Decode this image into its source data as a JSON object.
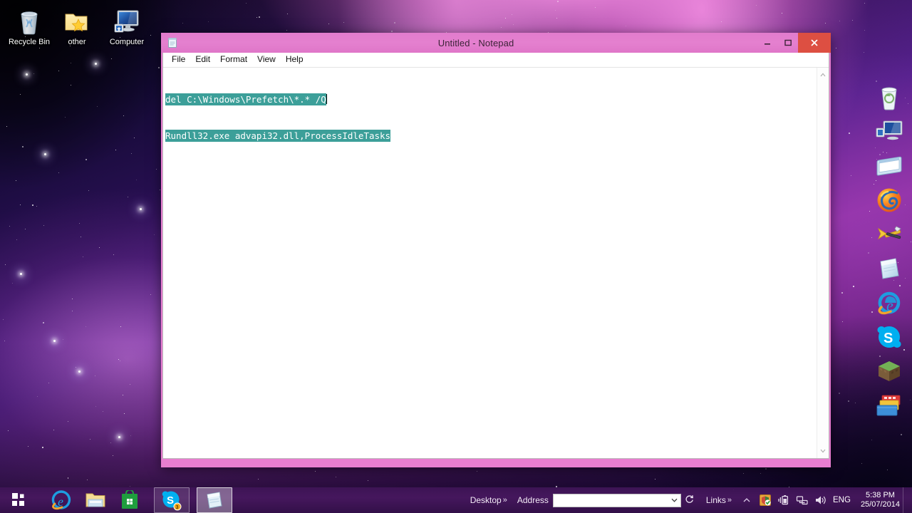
{
  "desktop": {
    "icons": [
      {
        "label": "Recycle Bin",
        "icon": "recycle-bin-icon"
      },
      {
        "label": "other",
        "icon": "folder-star-icon"
      },
      {
        "label": "Computer",
        "icon": "computer-icon"
      }
    ]
  },
  "dock": {
    "items": [
      {
        "name": "recycle-bin-icon",
        "label": "Recycle Bin"
      },
      {
        "name": "computer-icon",
        "label": "Computer"
      },
      {
        "name": "window-explorer-icon",
        "label": "Window"
      },
      {
        "name": "firefox-icon",
        "label": "Firefox"
      },
      {
        "name": "tools-icon",
        "label": "Tools"
      },
      {
        "name": "notepad-icon",
        "label": "Notepad"
      },
      {
        "name": "internet-explorer-icon",
        "label": "Internet Explorer"
      },
      {
        "name": "skype-icon",
        "label": "Skype"
      },
      {
        "name": "minecraft-icon",
        "label": "Minecraft"
      },
      {
        "name": "stack-folders-icon",
        "label": "Folders"
      }
    ]
  },
  "notepad": {
    "title": "Untitled - Notepad",
    "title_icon": "notepad-icon",
    "menus": [
      "File",
      "Edit",
      "Format",
      "View",
      "Help"
    ],
    "controls": {
      "minimize": "minimize-icon",
      "maximize": "maximize-icon",
      "close": "close-icon"
    },
    "content_lines": [
      "del C:\\Windows\\Prefetch\\*.* /Q",
      "Rundll32.exe advapi32.dll,ProcessIdleTasks"
    ],
    "selection_color": "#3c9f99",
    "scrollbar": {
      "up": "▲",
      "down": "▼"
    }
  },
  "taskbar": {
    "start": {
      "name": "start-button",
      "label": "Start"
    },
    "pinned": [
      {
        "name": "internet-explorer-icon",
        "label": "Internet Explorer"
      },
      {
        "name": "file-explorer-icon",
        "label": "File Explorer"
      },
      {
        "name": "windows-store-icon",
        "label": "Store"
      }
    ],
    "running": [
      {
        "name": "skype-icon",
        "label": "Skype",
        "badge": "3",
        "active": false
      },
      {
        "name": "notepad-icon",
        "label": "Untitled - Notepad",
        "badge": "",
        "active": true
      }
    ],
    "toolbars": {
      "desktop_label": "Desktop",
      "desktop_chevron": "»",
      "address_label": "Address",
      "address_value": "",
      "address_placeholder": "",
      "address_dropdown": "⌄",
      "address_refresh": "⟳",
      "links_label": "Links",
      "links_chevron": "»"
    },
    "tray": {
      "show_hidden": "▲",
      "icons": [
        {
          "name": "security-shield-icon",
          "label": "Security"
        },
        {
          "name": "battery-icon",
          "label": "Battery"
        },
        {
          "name": "network-icon",
          "label": "Network"
        },
        {
          "name": "volume-icon",
          "label": "Volume"
        }
      ],
      "language": "ENG",
      "time": "5:38 PM",
      "date": "25/07/2014"
    }
  },
  "colors": {
    "window_frame": "#e87fd0",
    "titlebar": "#e480cf",
    "close_button": "#dd4f42",
    "taskbar": "#48185f",
    "selection": "#3c9f99"
  }
}
